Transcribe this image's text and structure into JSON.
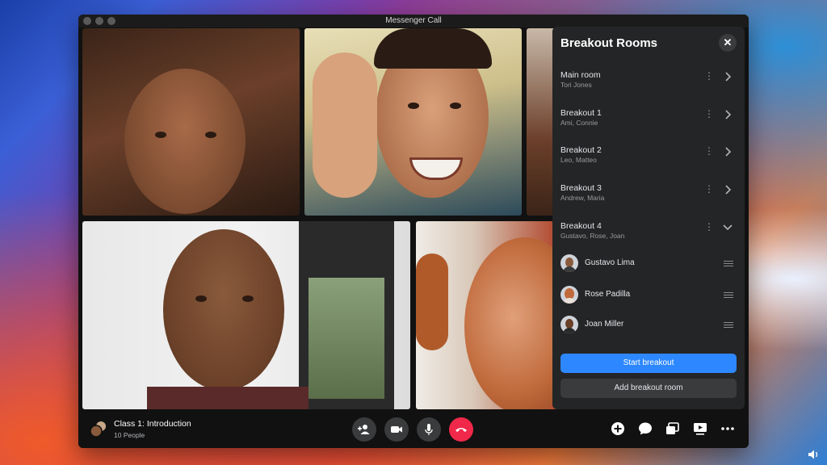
{
  "window": {
    "title": "Messenger Call"
  },
  "breakout_panel": {
    "title": "Breakout Rooms",
    "rooms": [
      {
        "name": "Main room",
        "members": "Tori Jones",
        "expanded": false
      },
      {
        "name": "Breakout 1",
        "members": "Ami, Connie",
        "expanded": false
      },
      {
        "name": "Breakout 2",
        "members": "Leo, Matteo",
        "expanded": false
      },
      {
        "name": "Breakout 3",
        "members": "Andrew, Maria",
        "expanded": false
      },
      {
        "name": "Breakout 4",
        "members": "Gustavo, Rose, Joan",
        "expanded": true
      }
    ],
    "expanded_members": [
      {
        "name": "Gustavo Lima"
      },
      {
        "name": "Rose Padilla"
      },
      {
        "name": "Joan Miller"
      }
    ],
    "start_label": "Start breakout",
    "add_label": "Add breakout room",
    "accent": "#2d88ff"
  },
  "call": {
    "title": "Class 1: Introduction",
    "people": "10 People"
  },
  "controls": {
    "add_person": "add-person-icon",
    "video": "video-camera-icon",
    "mic": "microphone-icon",
    "end": "end-call-icon",
    "end_color": "#f02849"
  }
}
